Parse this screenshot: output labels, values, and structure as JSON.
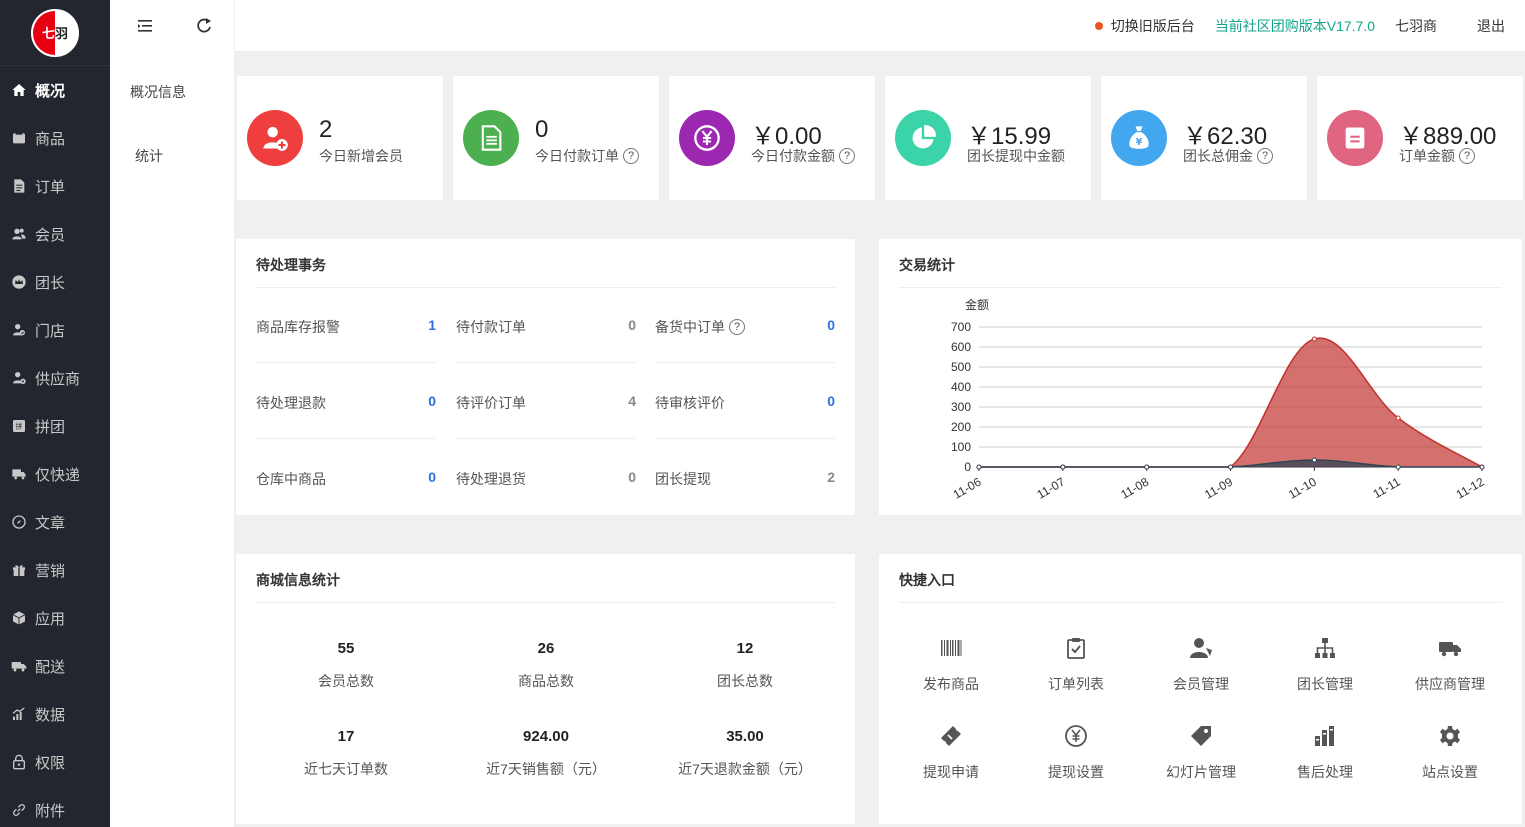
{
  "logo": {
    "text_left": "七",
    "text_right": "羽"
  },
  "sidebar": {
    "items": [
      {
        "label": "概况",
        "icon": "home-icon",
        "active": true
      },
      {
        "label": "商品",
        "icon": "goods-icon"
      },
      {
        "label": "订单",
        "icon": "order-icon"
      },
      {
        "label": "会员",
        "icon": "members-icon"
      },
      {
        "label": "团长",
        "icon": "crown-icon"
      },
      {
        "label": "门店",
        "icon": "store-icon"
      },
      {
        "label": "供应商",
        "icon": "supplier-icon"
      },
      {
        "label": "拼团",
        "icon": "groupbuy-icon"
      },
      {
        "label": "仅快递",
        "icon": "delivery-icon"
      },
      {
        "label": "文章",
        "icon": "compass-icon"
      },
      {
        "label": "营销",
        "icon": "gift-icon"
      },
      {
        "label": "应用",
        "icon": "cube-icon"
      },
      {
        "label": "配送",
        "icon": "truck-icon"
      },
      {
        "label": "数据",
        "icon": "chart-icon"
      },
      {
        "label": "权限",
        "icon": "lock-icon"
      },
      {
        "label": "附件",
        "icon": "link-icon"
      }
    ]
  },
  "subnav": {
    "items": [
      "概况信息",
      "统计"
    ]
  },
  "topbar": {
    "switch_label": "切换旧版后台",
    "version_label": "当前社区团购版本V17.7.0",
    "user_label": "七羽商",
    "logout_label": "退出",
    "status_color": "#f0541e"
  },
  "stats": [
    {
      "value": "2",
      "label": "今日新增会员",
      "help": false,
      "color": "#ee3e3e",
      "icon": "add-user-icon"
    },
    {
      "value": "0",
      "label": "今日付款订单",
      "help": true,
      "color": "#4caf50",
      "icon": "document-icon"
    },
    {
      "value": "￥0.00",
      "label": "今日付款金额",
      "help": true,
      "color": "#9c27b0",
      "icon": "yen-coin-icon"
    },
    {
      "value": "￥15.99",
      "label": "团长提现中金额",
      "help": false,
      "color": "#3bd3a8",
      "icon": "pie-icon"
    },
    {
      "value": "￥62.30",
      "label": "团长总佣金",
      "help": true,
      "color": "#43a7f0",
      "icon": "money-bag-icon"
    },
    {
      "value": "￥889.00",
      "label": "订单金额",
      "help": true,
      "color": "#e06581",
      "icon": "receipt-icon"
    }
  ],
  "help_glyph": "?",
  "pending": {
    "title": "待处理事务",
    "items": [
      {
        "label": "商品库存报警",
        "count": "1",
        "style": "blue",
        "help": false
      },
      {
        "label": "待付款订单",
        "count": "0",
        "style": "gray",
        "help": false
      },
      {
        "label": "备货中订单",
        "count": "0",
        "style": "blue",
        "help": true
      },
      {
        "label": "待处理退款",
        "count": "0",
        "style": "blue",
        "help": false
      },
      {
        "label": "待评价订单",
        "count": "4",
        "style": "gray",
        "help": false
      },
      {
        "label": "待审核评价",
        "count": "0",
        "style": "blue",
        "help": false
      },
      {
        "label": "仓库中商品",
        "count": "0",
        "style": "blue",
        "help": false
      },
      {
        "label": "待处理退货",
        "count": "0",
        "style": "gray",
        "help": false
      },
      {
        "label": "团长提现",
        "count": "2",
        "style": "gray",
        "help": false
      }
    ]
  },
  "trade": {
    "title": "交易统计"
  },
  "mall": {
    "title": "商城信息统计",
    "items": [
      {
        "value": "55",
        "label": "会员总数"
      },
      {
        "value": "26",
        "label": "商品总数"
      },
      {
        "value": "12",
        "label": "团长总数"
      },
      {
        "value": "17",
        "label": "近七天订单数"
      },
      {
        "value": "924.00",
        "label": "近7天销售额（元）"
      },
      {
        "value": "35.00",
        "label": "近7天退款金额（元）"
      }
    ]
  },
  "quick": {
    "title": "快捷入口",
    "items": [
      {
        "label": "发布商品",
        "icon": "barcode-icon"
      },
      {
        "label": "订单列表",
        "icon": "clipboard-check-icon"
      },
      {
        "label": "会员管理",
        "icon": "user-manage-icon"
      },
      {
        "label": "团长管理",
        "icon": "org-tree-icon"
      },
      {
        "label": "供应商管理",
        "icon": "truck-icon"
      },
      {
        "label": "提现申请",
        "icon": "ticket-icon"
      },
      {
        "label": "提现设置",
        "icon": "yen-circle-icon"
      },
      {
        "label": "幻灯片管理",
        "icon": "tag-icon"
      },
      {
        "label": "售后处理",
        "icon": "bars-icon"
      },
      {
        "label": "站点设置",
        "icon": "gear-icon"
      }
    ]
  },
  "chart_data": {
    "type": "area",
    "ylabel": "金额",
    "x": [
      "11-06",
      "11-07",
      "11-08",
      "11-09",
      "11-10",
      "11-11",
      "11-12"
    ],
    "ylim": [
      0,
      700
    ],
    "yticks": [
      0,
      100,
      200,
      300,
      400,
      500,
      600,
      700
    ],
    "series": [
      {
        "values": [
          0,
          0,
          0,
          0,
          640,
          245,
          0
        ],
        "color": "#c23531"
      },
      {
        "values": [
          0,
          0,
          0,
          0,
          35,
          0,
          0
        ],
        "color": "#2f4554"
      }
    ],
    "grid": true,
    "smooth": true
  }
}
